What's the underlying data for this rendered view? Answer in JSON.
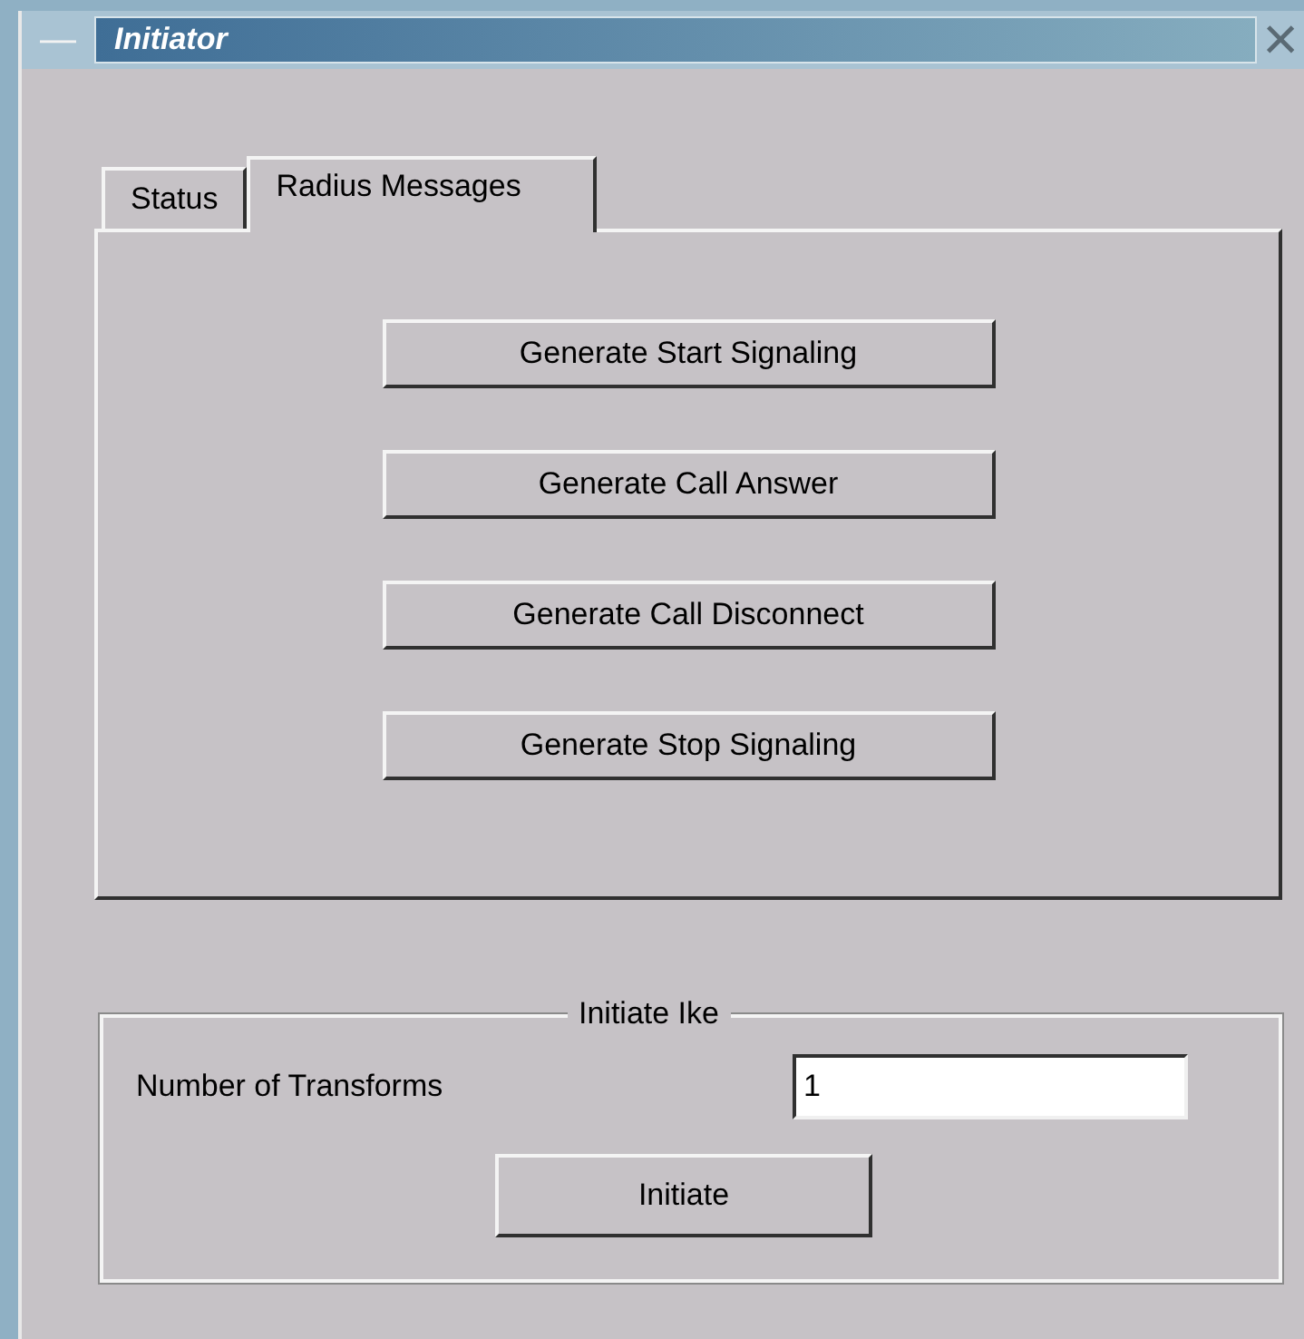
{
  "window": {
    "title": "Initiator",
    "minimize": "—",
    "close": "×"
  },
  "tabs": [
    {
      "label": "Status",
      "selected": false
    },
    {
      "label": "Radius Messages",
      "selected": true
    }
  ],
  "buttons": [
    "Generate Start Signaling",
    "Generate Call Answer",
    "Generate Call Disconnect",
    "Generate Stop Signaling"
  ],
  "group": {
    "title": "Initiate Ike",
    "field_label": "Number of Transforms",
    "field_value": "1",
    "button": "Initiate"
  }
}
